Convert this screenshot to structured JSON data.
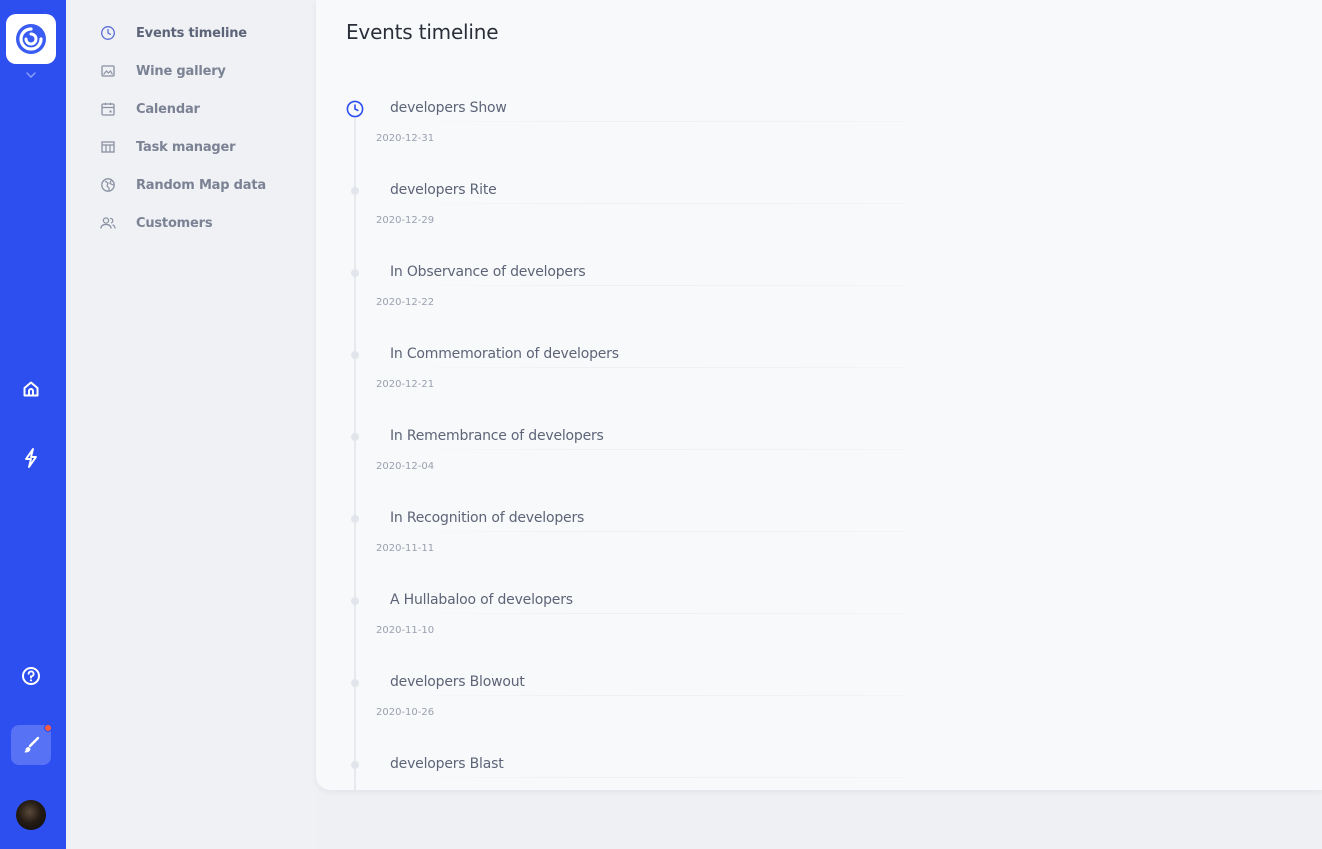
{
  "rail": {
    "logo_icon": "swirl-logo-icon",
    "items": [
      {
        "name": "home",
        "icon": "home-icon"
      },
      {
        "name": "activity",
        "icon": "bolt-icon"
      },
      {
        "name": "help",
        "icon": "question-icon"
      },
      {
        "name": "theme",
        "icon": "brush-icon"
      }
    ],
    "colors": {
      "background": "#2e4ff0",
      "notification": "#ff5a3c"
    }
  },
  "sidebar": {
    "items": [
      {
        "label": "Events timeline",
        "icon": "clock-icon",
        "active": true
      },
      {
        "label": "Wine gallery",
        "icon": "image-icon",
        "active": false
      },
      {
        "label": "Calendar",
        "icon": "calendar-icon",
        "active": false
      },
      {
        "label": "Task manager",
        "icon": "table-icon",
        "active": false
      },
      {
        "label": "Random Map data",
        "icon": "globe-icon",
        "active": false
      },
      {
        "label": "Customers",
        "icon": "users-icon",
        "active": false
      }
    ]
  },
  "main": {
    "title": "Events timeline",
    "events": [
      {
        "title": "developers Show",
        "date": "2020-12-31"
      },
      {
        "title": "developers Rite",
        "date": "2020-12-29"
      },
      {
        "title": "In Observance of developers",
        "date": "2020-12-22"
      },
      {
        "title": "In Commemoration of developers",
        "date": "2020-12-21"
      },
      {
        "title": "In Remembrance of developers",
        "date": "2020-12-04"
      },
      {
        "title": "In Recognition of developers",
        "date": "2020-11-11"
      },
      {
        "title": "A Hullabaloo of developers",
        "date": "2020-11-10"
      },
      {
        "title": "developers Blowout",
        "date": "2020-10-26"
      },
      {
        "title": "developers Blast",
        "date": ""
      }
    ]
  }
}
